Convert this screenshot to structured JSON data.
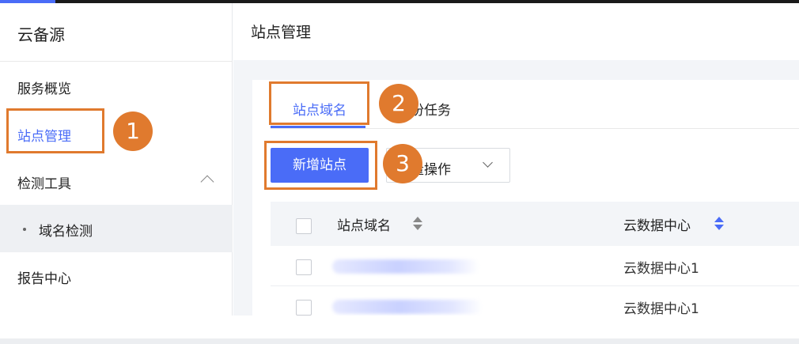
{
  "app": {
    "title": "云备源"
  },
  "sidebar": {
    "items": [
      {
        "label": "服务概览"
      },
      {
        "label": "站点管理"
      },
      {
        "label": "检测工具"
      },
      {
        "label": "域名检测"
      },
      {
        "label": "报告中心"
      }
    ]
  },
  "header": {
    "title": "站点管理"
  },
  "tabs": [
    {
      "label": "站点域名",
      "active": true
    },
    {
      "label": "份任务",
      "active": false
    }
  ],
  "toolbar": {
    "add_label": "新增站点",
    "batch_label": "量操作"
  },
  "table": {
    "columns": [
      {
        "label": "站点域名",
        "sortable": true
      },
      {
        "label": "云数据中心",
        "sortable": true
      }
    ],
    "rows": [
      {
        "domain": "",
        "datacenter": "云数据中心1"
      },
      {
        "domain": "",
        "datacenter": "云数据中心1"
      }
    ]
  },
  "annotations": [
    "1",
    "2",
    "3"
  ],
  "colors": {
    "accent": "#4a6cf7",
    "annotation": "#e07a2e",
    "sidebar_selected_bg": "#eef0f3",
    "table_header_bg": "#f3f5f8"
  },
  "icons": [
    "chevron-up-icon",
    "chevron-down-icon",
    "sort-icon",
    "checkbox-icon"
  ]
}
